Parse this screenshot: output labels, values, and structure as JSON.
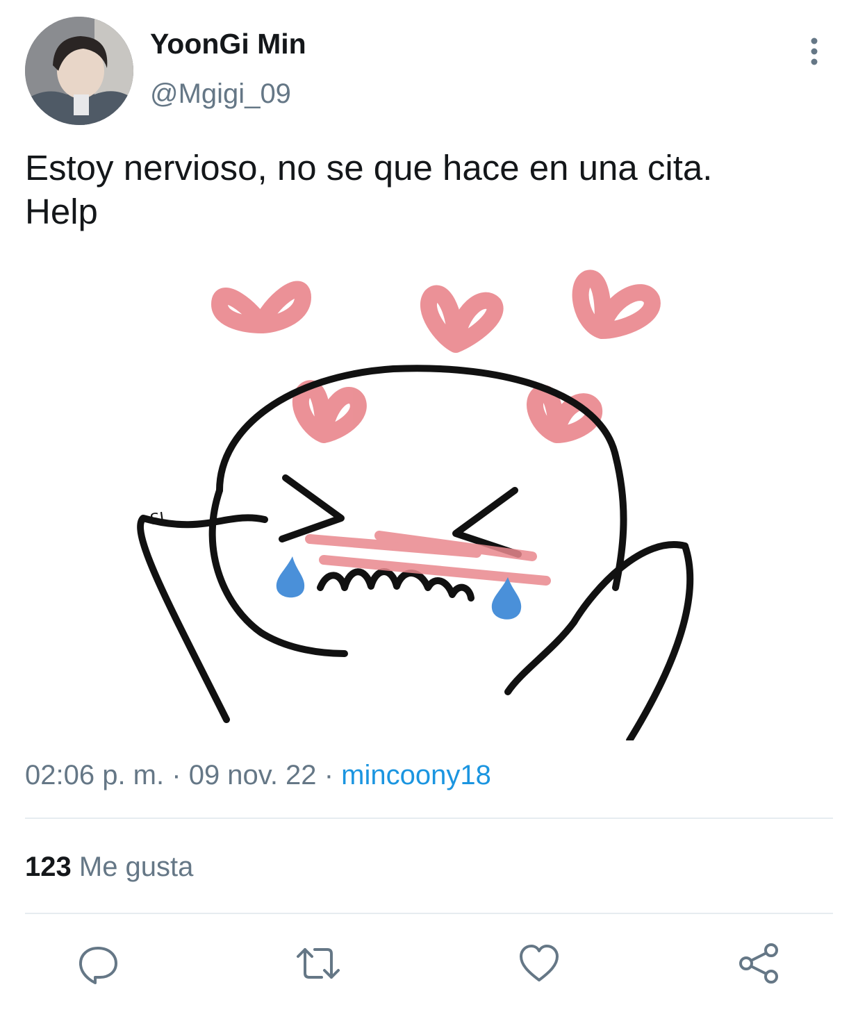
{
  "tweet": {
    "author_name": "YoonGi Min",
    "author_handle": "@Mgigi_09",
    "text_line1": "Estoy nervioso, no se que hace en una cita.",
    "text_line2": "Help",
    "media_signature": "SL",
    "time": "02:06 p. m.",
    "date": "09 nov. 22",
    "separator": "·",
    "source": "mincoony18",
    "likes_count": "123",
    "likes_label": "Me gusta"
  },
  "actions": {
    "reply_icon": "reply-icon",
    "retweet_icon": "retweet-icon",
    "like_icon": "heart-icon",
    "share_icon": "share-icon"
  },
  "colors": {
    "accent": "#1b95e0",
    "secondary_text": "#657786",
    "primary_text": "#14171a",
    "divider": "#e6ecf0",
    "hearts": "#e9888e",
    "tears": "#4a90d9"
  }
}
